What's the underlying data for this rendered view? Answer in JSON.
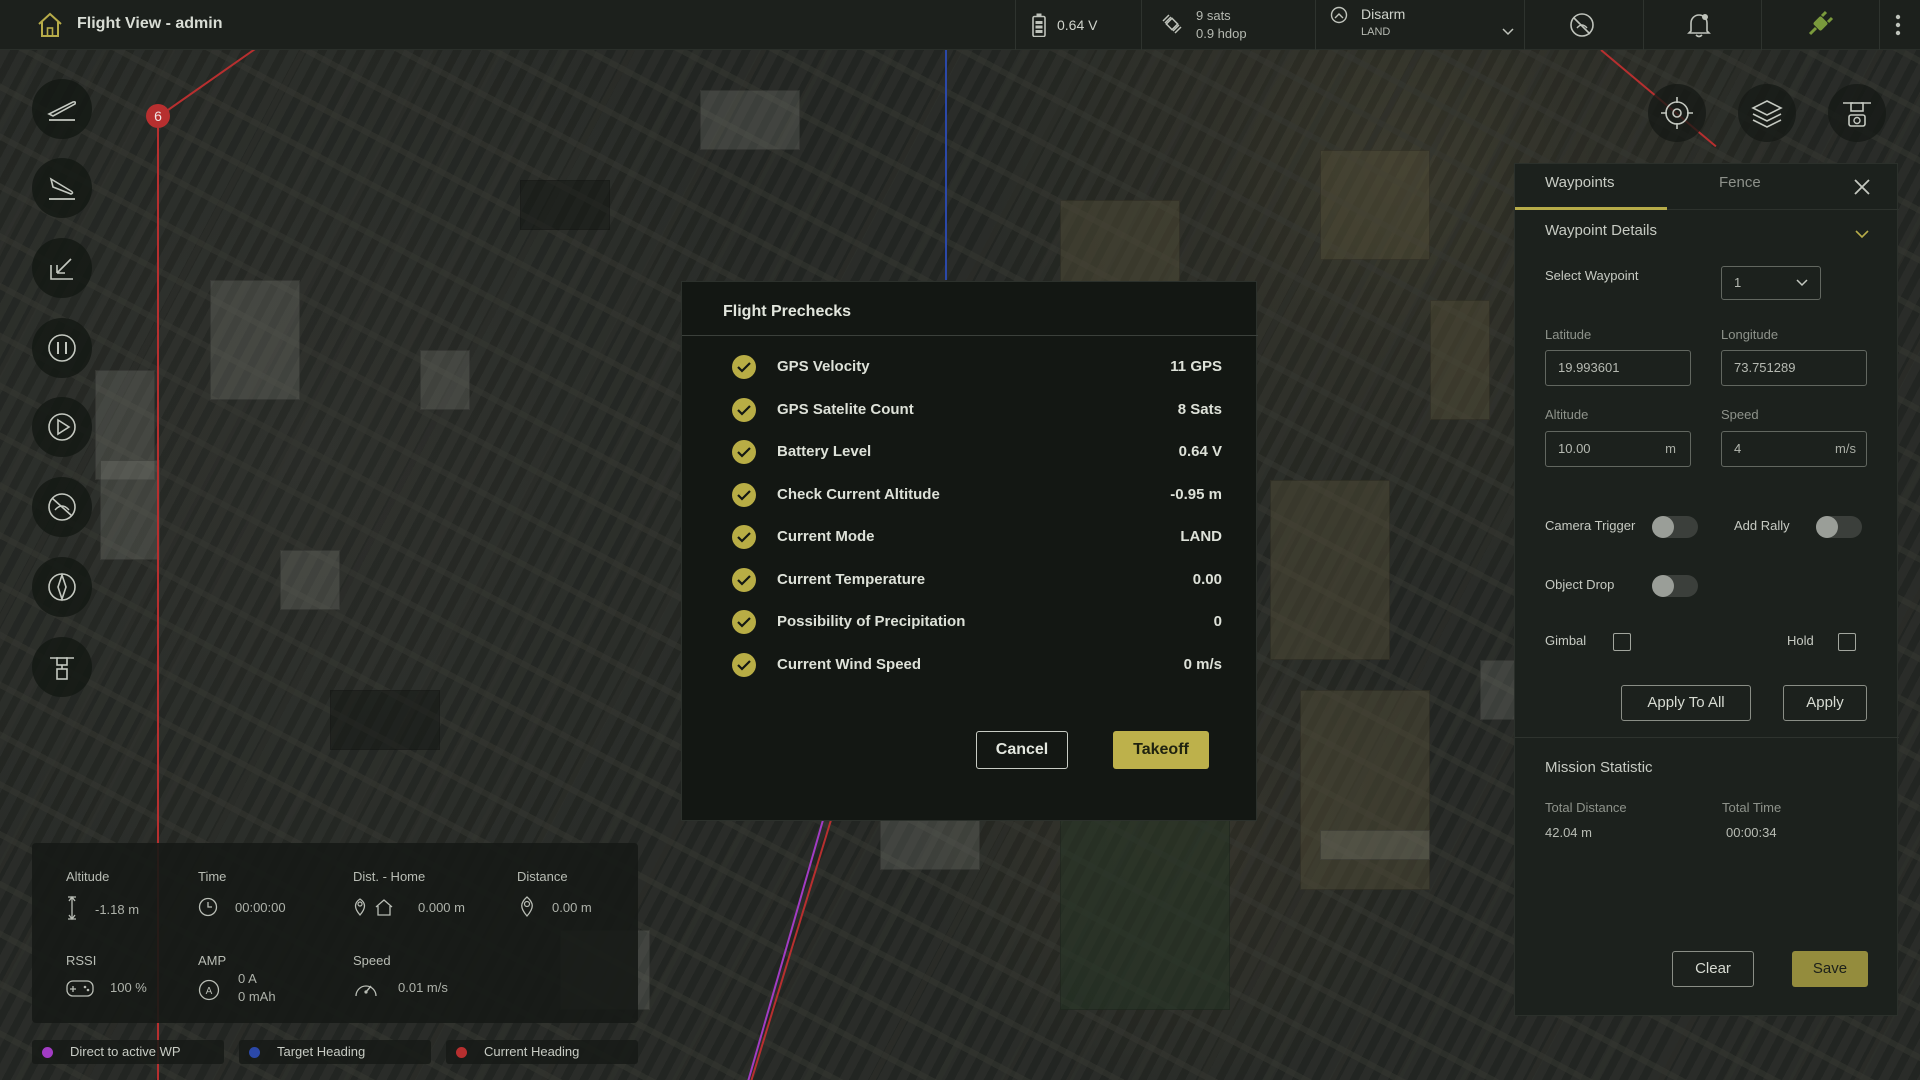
{
  "app": {
    "title": "Flight View - admin"
  },
  "topbar": {
    "battery_voltage": "0.64 V",
    "gps_sats": "9 sats",
    "gps_hdop": "0.9 hdop",
    "arm_state": "Disarm",
    "flight_mode": "LAND"
  },
  "map": {
    "waypoint_marker": "6"
  },
  "right_panel": {
    "tabs": [
      "Waypoints",
      "Fence"
    ],
    "waypoint_details_title": "Waypoint Details",
    "select_waypoint_label": "Select Waypoint",
    "select_waypoint_value": "1",
    "latitude_label": "Latitude",
    "latitude_value": "19.993601",
    "longitude_label": "Longitude",
    "longitude_value": "73.751289",
    "altitude_label": "Altitude",
    "altitude_value": "10.00",
    "altitude_unit": "m",
    "speed_label": "Speed",
    "speed_value": "4",
    "speed_unit": "m/s",
    "camera_trigger_label": "Camera Trigger",
    "camera_trigger_on": false,
    "add_rally_label": "Add Rally",
    "add_rally_on": false,
    "object_drop_label": "Object Drop",
    "object_drop_on": false,
    "gimbal_label": "Gimbal",
    "gimbal_checked": false,
    "hold_label": "Hold",
    "hold_checked": false,
    "apply_to_all_label": "Apply To All",
    "apply_label": "Apply",
    "mission_statistic_title": "Mission Statistic",
    "total_distance_label": "Total Distance",
    "total_distance_value": "42.04 m",
    "total_time_label": "Total Time",
    "total_time_value": "00:00:34",
    "clear_label": "Clear",
    "save_label": "Save"
  },
  "telemetry": {
    "altitude_label": "Altitude",
    "altitude_value": "-1.18 m",
    "time_label": "Time",
    "time_value": "00:00:00",
    "dist_home_label": "Dist. - Home",
    "dist_home_value": "0.000 m",
    "distance_label": "Distance",
    "distance_value": "0.00 m",
    "rssi_label": "RSSI",
    "rssi_value": "100 %",
    "amp_label": "AMP",
    "amp_value": "0 A",
    "mah_value": "0 mAh",
    "speed_label": "Speed",
    "speed_value": "0.01 m/s"
  },
  "legend": [
    {
      "label": "Direct to active WP",
      "color": "#a23cc4"
    },
    {
      "label": "Target Heading",
      "color": "#2b48a8"
    },
    {
      "label": "Current Heading",
      "color": "#b72f2f"
    }
  ],
  "modal": {
    "title": "Flight Prechecks",
    "checks": [
      {
        "label": "GPS Velocity",
        "value": "11 GPS"
      },
      {
        "label": "GPS Satelite Count",
        "value": "8 Sats"
      },
      {
        "label": "Battery Level",
        "value": "0.64 V"
      },
      {
        "label": "Check Current Altitude",
        "value": "-0.95 m"
      },
      {
        "label": "Current Mode",
        "value": "LAND"
      },
      {
        "label": "Current Temperature",
        "value": "0.00"
      },
      {
        "label": "Possibility of Precipitation",
        "value": "0"
      },
      {
        "label": "Current Wind Speed",
        "value": "0 m/s"
      }
    ],
    "cancel_label": "Cancel",
    "takeoff_label": "Takeoff"
  },
  "colors": {
    "accent": "#bdb14b",
    "panel_bg": "#1c211d",
    "modal_bg": "#131713"
  },
  "icons": {
    "home": "home-icon",
    "battery": "battery-icon",
    "satellite": "satellite-icon",
    "arm": "arm-icon",
    "no_signal": "no-signal-icon",
    "bell": "bell-icon",
    "plug": "plug-icon",
    "kebab": "more-vert-icon"
  }
}
